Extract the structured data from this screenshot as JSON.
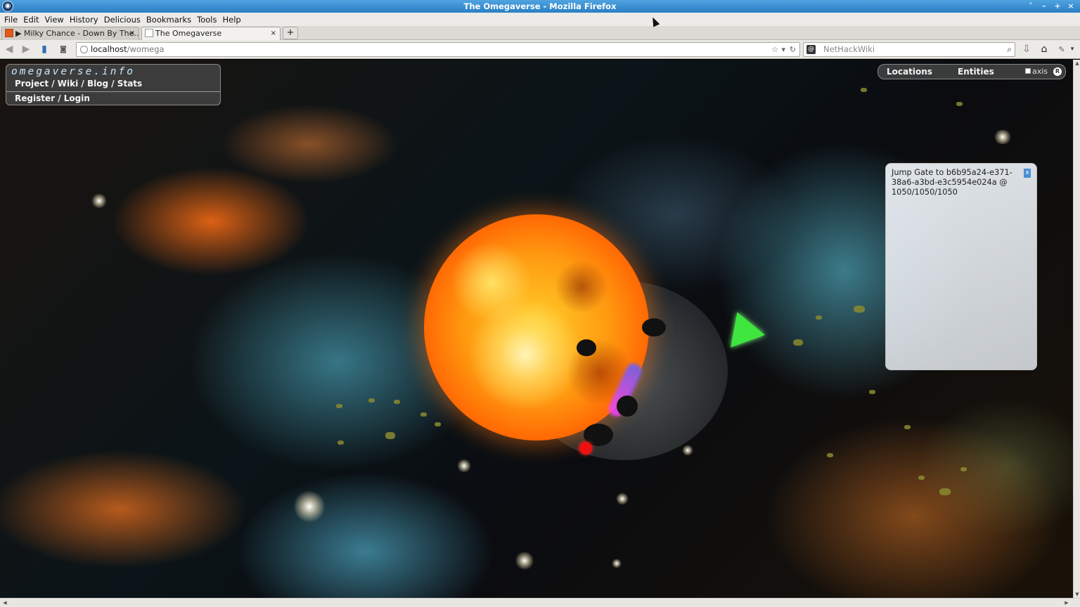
{
  "window": {
    "title": "The Omegaverse - Mozilla Firefox"
  },
  "menu": [
    "File",
    "Edit",
    "View",
    "History",
    "Delicious",
    "Bookmarks",
    "Tools",
    "Help"
  ],
  "tabs": [
    {
      "label": "▶ Milky Chance - Down By The...",
      "active": false,
      "icon": "youtube-favicon"
    },
    {
      "label": "The Omegaverse",
      "active": true,
      "icon": "blank-favicon"
    }
  ],
  "tab_close": "×",
  "new_tab": "+",
  "nav": {
    "url_host": "localhost",
    "url_path": "/womega",
    "search_engine": "NetHackWiki",
    "search_placeholder": "NetHackWiki"
  },
  "site": {
    "brand": "omegaverse.info",
    "links": "Project / Wiki / Blog / Stats",
    "account": "Register / Login"
  },
  "topnav": {
    "locations": "Locations",
    "entities": "Entities",
    "axis_label": "axis",
    "axis_checked": false,
    "r_button": "R"
  },
  "dialog": {
    "text": "Jump Gate to b6b95a24-e371-38a6-a3bd-e3c5954e024a @ 1050/1050/1050",
    "close": "x"
  },
  "colors": {
    "titlebar": "#2a7fc4",
    "accent_sun": "#ff9a10",
    "shard": "#3ee63e"
  }
}
